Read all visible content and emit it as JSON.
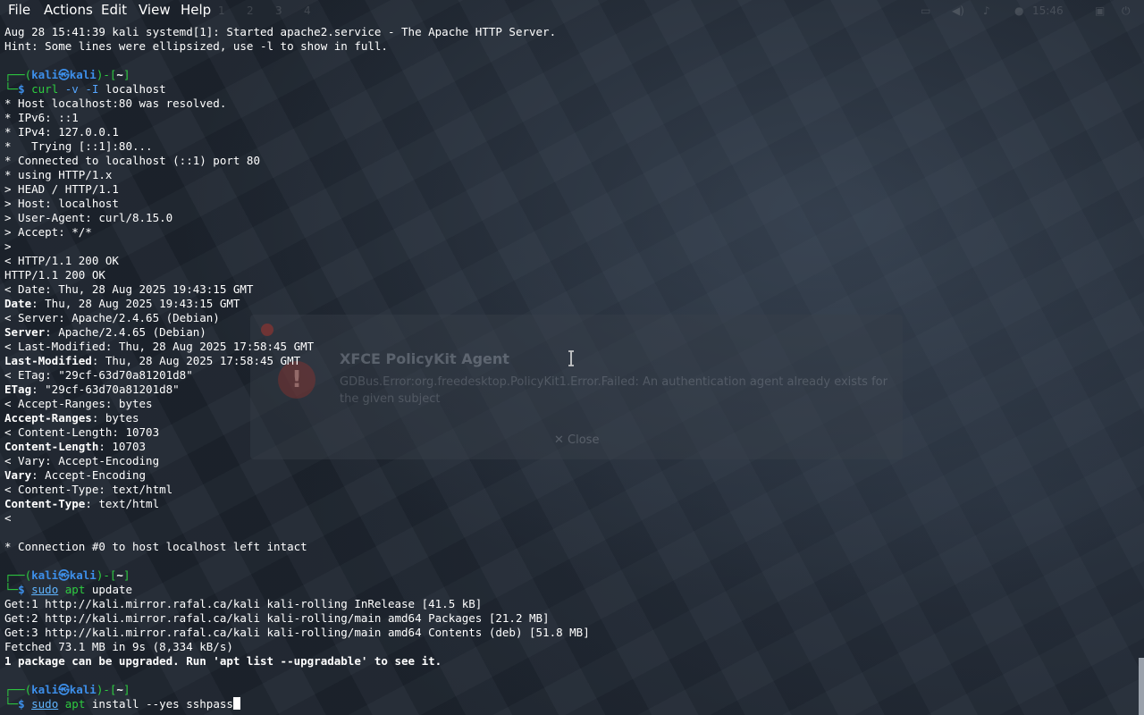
{
  "menubar": {
    "items": [
      "File",
      "Actions",
      "Edit",
      "View",
      "Help"
    ]
  },
  "panel": {
    "workspaces": [
      "1",
      "2",
      "3",
      "4"
    ],
    "clock": "15:46"
  },
  "dialog": {
    "title": "XFCE PolicyKit Agent",
    "message": "GDBus.Error:org.freedesktop.PolicyKit1.Error.Failed: An authentication agent already exists for the given subject",
    "close_label": "Close"
  },
  "prompt": {
    "user": "kali",
    "host": "kali",
    "dir": "~"
  },
  "terminal": {
    "pre": [
      "Aug 28 15:41:39 kali systemd[1]: Started apache2.service - The Apache HTTP Server.",
      "Hint: Some lines were ellipsized, use -l to show in full.",
      ""
    ],
    "cmd1": {
      "parts": [
        "curl",
        " -v -I ",
        "localhost"
      ]
    },
    "curl_output": [
      "* Host localhost:80 was resolved.",
      "* IPv6: ::1",
      "* IPv4: 127.0.0.1",
      "*   Trying [::1]:80...",
      "* Connected to localhost (::1) port 80",
      "* using HTTP/1.x",
      "> HEAD / HTTP/1.1",
      "> Host: localhost",
      "> User-Agent: curl/8.15.0",
      "> Accept: */*",
      ">",
      "< HTTP/1.1 200 OK",
      "HTTP/1.1 200 OK",
      "< Date: Thu, 28 Aug 2025 19:43:15 GMT",
      {
        "key": "Date",
        "val": ": Thu, 28 Aug 2025 19:43:15 GMT"
      },
      "< Server: Apache/2.4.65 (Debian)",
      {
        "key": "Server",
        "val": ": Apache/2.4.65 (Debian)"
      },
      "< Last-Modified: Thu, 28 Aug 2025 17:58:45 GMT",
      {
        "key": "Last-Modified",
        "val": ": Thu, 28 Aug 2025 17:58:45 GMT"
      },
      "< ETag: \"29cf-63d70a81201d8\"",
      {
        "key": "ETag",
        "val": ": \"29cf-63d70a81201d8\""
      },
      "< Accept-Ranges: bytes",
      {
        "key": "Accept-Ranges",
        "val": ": bytes"
      },
      "< Content-Length: 10703",
      {
        "key": "Content-Length",
        "val": ": 10703"
      },
      "< Vary: Accept-Encoding",
      {
        "key": "Vary",
        "val": ": Accept-Encoding"
      },
      "< Content-Type: text/html",
      {
        "key": "Content-Type",
        "val": ": text/html"
      },
      "<",
      "",
      "* Connection #0 to host localhost left intact",
      ""
    ],
    "cmd2": {
      "parts": [
        "sudo",
        " ",
        "apt",
        " update"
      ]
    },
    "apt_output": [
      "Get:1 http://kali.mirror.rafal.ca/kali kali-rolling InRelease [41.5 kB]",
      "Get:2 http://kali.mirror.rafal.ca/kali kali-rolling/main amd64 Packages [21.2 MB]",
      "Get:3 http://kali.mirror.rafal.ca/kali kali-rolling/main amd64 Contents (deb) [51.8 MB]",
      "Fetched 73.1 MB in 9s (8,334 kB/s)",
      {
        "bold": "1 package can be upgraded. Run 'apt list --upgradable' to see it."
      },
      ""
    ],
    "cmd3": {
      "parts": [
        "sudo",
        " ",
        "apt",
        " install --yes sshpass"
      ]
    }
  }
}
